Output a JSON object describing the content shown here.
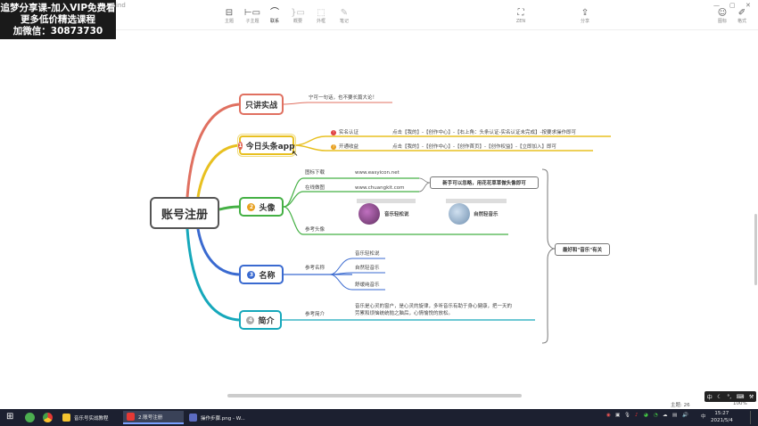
{
  "promo": {
    "line1": "追梦分享课-加入VIP免费看",
    "line2": "更多低价精选课程",
    "line3": "加微信：30873730"
  },
  "window": {
    "title_fragment": "ind"
  },
  "toolbar": {
    "items": [
      {
        "label": "主题"
      },
      {
        "label": "子主题"
      },
      {
        "label": "联系"
      },
      {
        "label": "概要"
      },
      {
        "label": "外框"
      },
      {
        "label": "笔记"
      }
    ],
    "zen_label": "ZEN",
    "share_label": "分享",
    "format_label": "格式",
    "icon_label": "图标"
  },
  "mindmap": {
    "root": "账号注册",
    "branches": [
      {
        "label": "只讲实战",
        "color": "#e07060",
        "notes": [
          "宁可一句话，也不要长篇大论！"
        ]
      },
      {
        "label": "今日头条app",
        "number": "1",
        "color": "#e8c020",
        "children": [
          {
            "label": "实名认证",
            "detail": "点击【我的】-【创作中心】-【右上角：头条认证-实名认证未完成】-按要求操作即可"
          },
          {
            "label": "开通收益",
            "detail": "点击【我的】-【创作中心】-【创作首页】-【创作权益】-【立即加入】即可"
          }
        ]
      },
      {
        "label": "头像",
        "number": "2",
        "color": "#44b044",
        "children": [
          {
            "label": "图标下载",
            "detail": "www.easyicon.net"
          },
          {
            "label": "在线做图",
            "detail": "www.chuangkit.com"
          },
          {
            "label": "参考头像"
          }
        ],
        "callout": "新手可以忽略，用花花草草做头像即可",
        "samples": [
          "音乐轻松说",
          "自然轻音乐"
        ]
      },
      {
        "label": "名称",
        "number": "3",
        "color": "#3a6ad0",
        "children": [
          {
            "label": "参考名称"
          }
        ],
        "names": [
          "音乐轻松说",
          "自然轻音乐",
          "舒缓纯音乐"
        ]
      },
      {
        "label": "简介",
        "number": "4",
        "color": "#16a8bb",
        "children": [
          {
            "label": "参考简介"
          }
        ],
        "intro": [
          "音乐是心灵的窗户，是心灵的旋律，多听音乐有助于身心健康，把一天的",
          "劳累和烦恼统统抛之脑后，心情愉悦的放松。"
        ]
      }
    ],
    "summary": "最好和\"音乐\"有关"
  },
  "status": {
    "topic_count": "主题: 26",
    "zoom": "100%"
  },
  "ime": {
    "text": "中"
  },
  "taskbar": {
    "apps": [
      {
        "label": "音乐号实战教程"
      },
      {
        "label": "2.账号注册"
      },
      {
        "label": "操作步骤.png - W..."
      }
    ],
    "tray_lang": "中",
    "time": "15:27",
    "date": "2021/5/4"
  }
}
